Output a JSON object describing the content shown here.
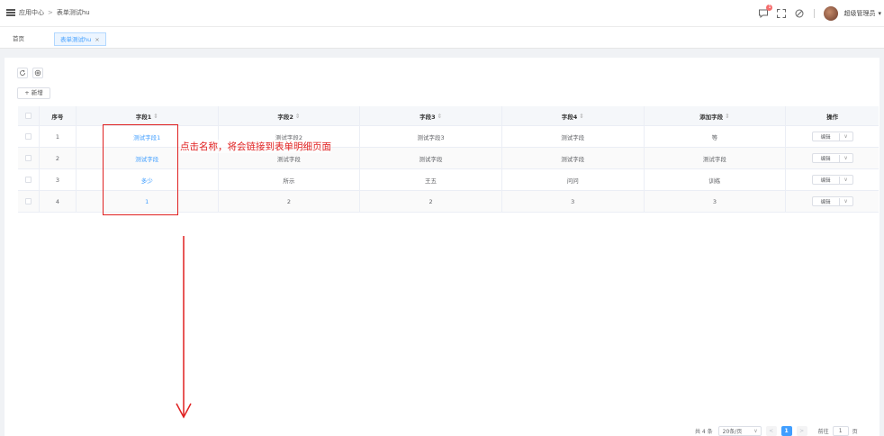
{
  "header": {
    "breadcrumb": [
      "应用中心",
      "表单测试hu"
    ],
    "breadcrumb_sep": ">",
    "notification_count": "1",
    "username": "超级管理员",
    "username_caret": "▾"
  },
  "tabs": [
    {
      "label": "首页",
      "active": false
    },
    {
      "label": "表单测试hu",
      "active": true,
      "close": "×"
    }
  ],
  "toolbar": {
    "add_label": "+ 新增",
    "refresh_icon": "refresh-icon",
    "settings_icon": "settings-icon"
  },
  "table": {
    "headers": [
      "序号",
      "字段1",
      "字段2",
      "字段3",
      "字段4",
      "添加字段",
      "操作"
    ],
    "sort_glyph": "⇕",
    "rows": [
      {
        "no": "1",
        "f1": "测试字段1",
        "f2": "测试字段2",
        "f3": "测试字段3",
        "f4": "测试字段",
        "f5": "等",
        "op": "编辑",
        "op_caret": "∨"
      },
      {
        "no": "2",
        "f1": "测试字段",
        "f2": "测试字段",
        "f3": "测试字段",
        "f4": "测试字段",
        "f5": "测试字段",
        "op": "编辑",
        "op_caret": "∨"
      },
      {
        "no": "3",
        "f1": "多少",
        "f2": "所示",
        "f3": "王五",
        "f4": "问问",
        "f5": "训练",
        "op": "编辑",
        "op_caret": "∨"
      },
      {
        "no": "4",
        "f1": "1",
        "f2": "2",
        "f3": "2",
        "f4": "3",
        "f5": "3",
        "op": "编辑",
        "op_caret": "∨"
      }
    ]
  },
  "annotation": {
    "text": "点击名称，将会链接到表单明细页面",
    "color": "#e02020"
  },
  "pagination": {
    "total": "共 4 条",
    "page_size": "20条/页",
    "page_size_caret": "∨",
    "prev": "<",
    "current": "1",
    "next": ">",
    "goto_label": "前往",
    "goto_value": "1",
    "goto_suffix": "页"
  },
  "colors": {
    "accent": "#409eff",
    "annotation": "#e02020"
  }
}
